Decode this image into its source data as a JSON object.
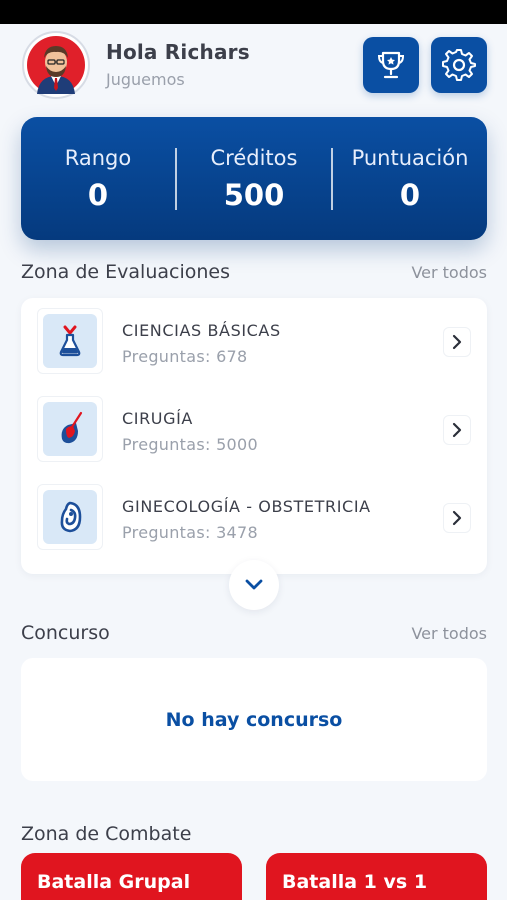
{
  "header": {
    "greeting": "Hola Richars",
    "subtitle": "Juguemos"
  },
  "stats": {
    "rank_label": "Rango",
    "rank_value": "0",
    "credits_label": "Créditos",
    "credits_value": "500",
    "score_label": "Puntuación",
    "score_value": "0"
  },
  "evaluations": {
    "title": "Zona de Evaluaciones",
    "link": "Ver todos",
    "items": [
      {
        "name": "CIENCIAS BÁSICAS",
        "count": "Preguntas: 678"
      },
      {
        "name": "CIRUGÍA",
        "count": "Preguntas: 5000"
      },
      {
        "name": "GINECOLOGÍA - OBSTETRICIA",
        "count": "Preguntas: 3478"
      }
    ]
  },
  "contest": {
    "title": "Concurso",
    "link": "Ver todos",
    "empty": "No hay concurso"
  },
  "combat": {
    "title": "Zona de Combate",
    "group": "Batalla Grupal",
    "duel": "Batalla 1 vs 1"
  },
  "colors": {
    "primary": "#0a4fa3",
    "accent_red": "#e0151f",
    "background": "#f4f7fb"
  },
  "icons": {
    "trophy": "trophy-icon",
    "settings": "gear-icon",
    "chevron_right": "chevron-right-icon",
    "chevron_down": "chevron-down-icon"
  }
}
